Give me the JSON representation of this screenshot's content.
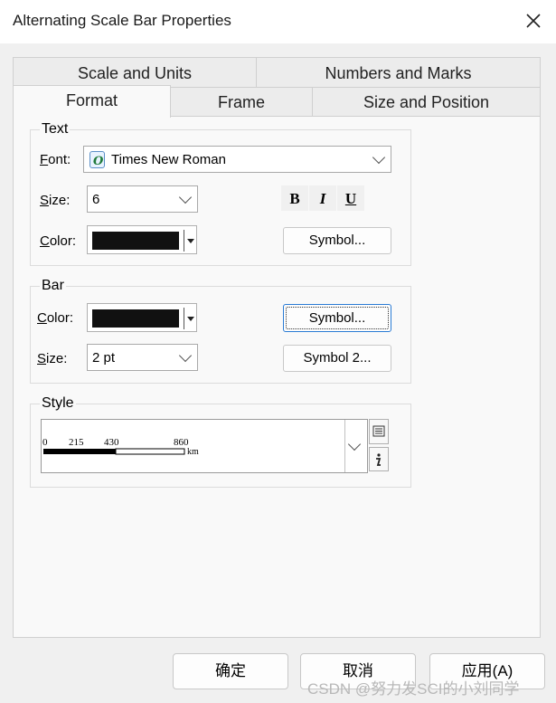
{
  "window": {
    "title": "Alternating Scale Bar Properties"
  },
  "tabs": {
    "row1": [
      "Scale and Units",
      "Numbers and Marks"
    ],
    "row2": [
      "Format",
      "Frame",
      "Size and Position"
    ],
    "active": "Format"
  },
  "text_group": {
    "label": "Text",
    "font_label": "Font:",
    "font_value": "Times New Roman",
    "size_label": "Size:",
    "size_value": "6",
    "color_label": "Color:",
    "color_value": "#111111",
    "bold_label": "B",
    "italic_label": "I",
    "underline_label": "U",
    "symbol_button": "Symbol..."
  },
  "bar_group": {
    "label": "Bar",
    "color_label": "Color:",
    "color_value": "#111111",
    "size_label": "Size:",
    "size_value": "2 pt",
    "symbol_button": "Symbol...",
    "symbol2_button": "Symbol 2..."
  },
  "style_group": {
    "label": "Style",
    "preview_ticks": [
      "0",
      "215",
      "430",
      "860"
    ],
    "preview_unit": "km"
  },
  "footer": {
    "ok": "确定",
    "cancel": "取消",
    "apply": "应用(A)"
  },
  "watermark": "CSDN @努力发SCI的小刘同学"
}
